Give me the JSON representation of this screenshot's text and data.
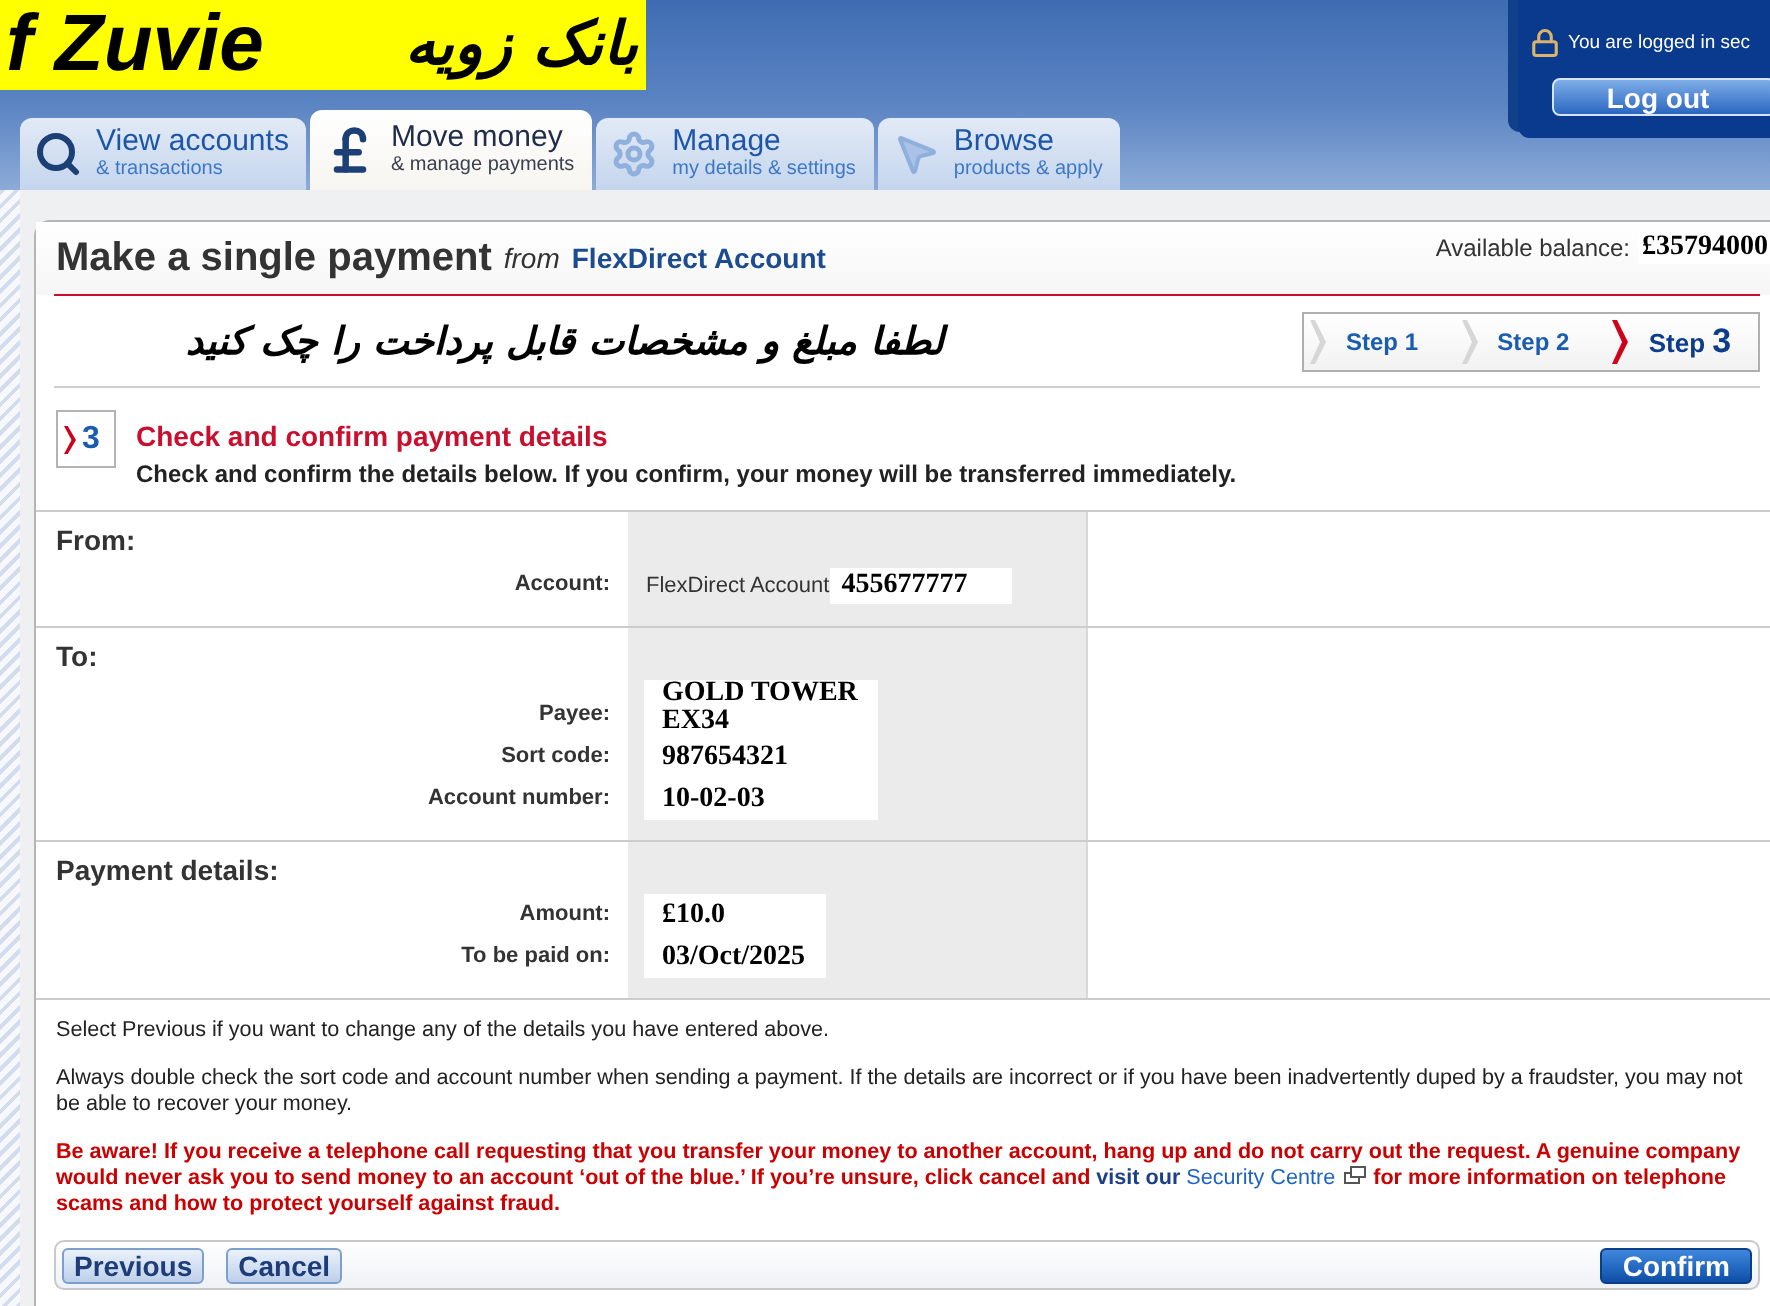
{
  "header": {
    "brand": {
      "latin": "f Zuvie",
      "persian": "بانک زویه"
    },
    "login": {
      "status": "You are logged in sec",
      "logout": "Log out"
    }
  },
  "tabs": [
    {
      "kind": "search",
      "title": "View accounts",
      "subtitle": "& transactions",
      "selected": false
    },
    {
      "kind": "pound",
      "title": "Move money",
      "subtitle": "& manage payments",
      "selected": true
    },
    {
      "kind": "gear",
      "title": "Manage",
      "subtitle": "my details & settings",
      "selected": false
    },
    {
      "kind": "pointer",
      "title": "Browse",
      "subtitle": "products & apply",
      "selected": false
    }
  ],
  "page": {
    "title": "Make a single payment",
    "from": "from",
    "account": "FlexDirect Account",
    "balance_label": "Available balance:",
    "balance": "£35794000"
  },
  "instruction": "لطفا مبلغ و مشخصات قابل پرداخت را چک کنید",
  "steps": [
    {
      "label": "Step",
      "number": "1",
      "selected": false
    },
    {
      "label": "Step",
      "number": "2",
      "selected": false
    },
    {
      "label": "Step",
      "number": "3",
      "selected": true
    }
  ],
  "section": {
    "step_number": "3",
    "heading": "Check and confirm payment details",
    "description": "Check and confirm the details below. If you confirm, your money will be transferred immediately."
  },
  "details": [
    {
      "heading": "From:",
      "fields": [
        {
          "label": "Account:",
          "account_name": "FlexDirect Account",
          "value": "455677777"
        }
      ]
    },
    {
      "heading": "To:",
      "fields": [
        {
          "label": "Payee:",
          "value": "GOLD TOWER\nEX34"
        },
        {
          "label": "Sort code:",
          "value": "987654321"
        },
        {
          "label": "Account number:",
          "value": "10-02-03"
        }
      ]
    },
    {
      "heading": "Payment details:",
      "fields": [
        {
          "label": "Amount:",
          "value": "£10.0"
        },
        {
          "label": "To be paid on:",
          "value": "03/Oct/2025"
        }
      ]
    }
  ],
  "notes": [
    "Select Previous if you want to change any of the details you have entered above.",
    "Always double check the sort code and account number when sending a payment. If the details are incorrect or if you have been inadvertently duped by a fraudster, you may not be able to recover your money."
  ],
  "warning": {
    "before": "Be aware! If you receive a telephone call requesting that you transfer your money to another account, hang up and do not carry out the request. A genuine company would never ask you to send money to an account ‘out of the blue.’ If you’re unsure, click cancel and",
    "link": "**visit our** Security Centre",
    "after": "for more information on telephone scams and how to protect yourself against fraud."
  },
  "buttons": [
    {
      "kind": "secondary",
      "label": "Previous"
    },
    {
      "kind": "secondary",
      "label": "Cancel"
    },
    {
      "kind": "primary",
      "label": "Confirm"
    }
  ]
}
